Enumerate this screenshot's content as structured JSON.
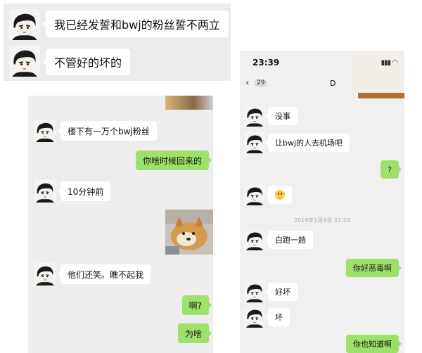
{
  "panel_a": {
    "messages": [
      {
        "text": "我已经发誓和bwj的粉丝誓不两立",
        "side": "left"
      },
      {
        "text": "不管好的坏的",
        "side": "left"
      }
    ]
  },
  "panel_b": {
    "messages": [
      {
        "text": "楼下有一万个bwj粉丝",
        "side": "left"
      },
      {
        "text": "你啥时候回来的",
        "side": "right"
      },
      {
        "text": "10分钟前",
        "side": "left"
      },
      {
        "text": "他们还笑。瞧不起我",
        "side": "left"
      },
      {
        "text": "啊?",
        "side": "right"
      },
      {
        "text": "为啥",
        "side": "right"
      }
    ]
  },
  "panel_c": {
    "status_time": "23:39",
    "unread_count": "29",
    "contact_name": "D",
    "timestamp": "2019年1月9日 22:24",
    "messages": [
      {
        "text": "没事",
        "side": "left"
      },
      {
        "text": "让bwj的人去机场吧",
        "side": "left"
      },
      {
        "text": "?",
        "side": "right"
      },
      {
        "text": "",
        "side": "left",
        "emoji": "smile-emoji"
      },
      {
        "text": "白跑一趟",
        "side": "left"
      },
      {
        "text": "你好恶毒啊",
        "side": "right"
      },
      {
        "text": "好坏",
        "side": "left"
      },
      {
        "text": "坏",
        "side": "left"
      },
      {
        "text": "你也知道啊",
        "side": "right"
      }
    ]
  },
  "colors": {
    "sent_bubble": "#9de16a",
    "received_bubble": "#ffffff",
    "chat_background": "#ededed"
  }
}
